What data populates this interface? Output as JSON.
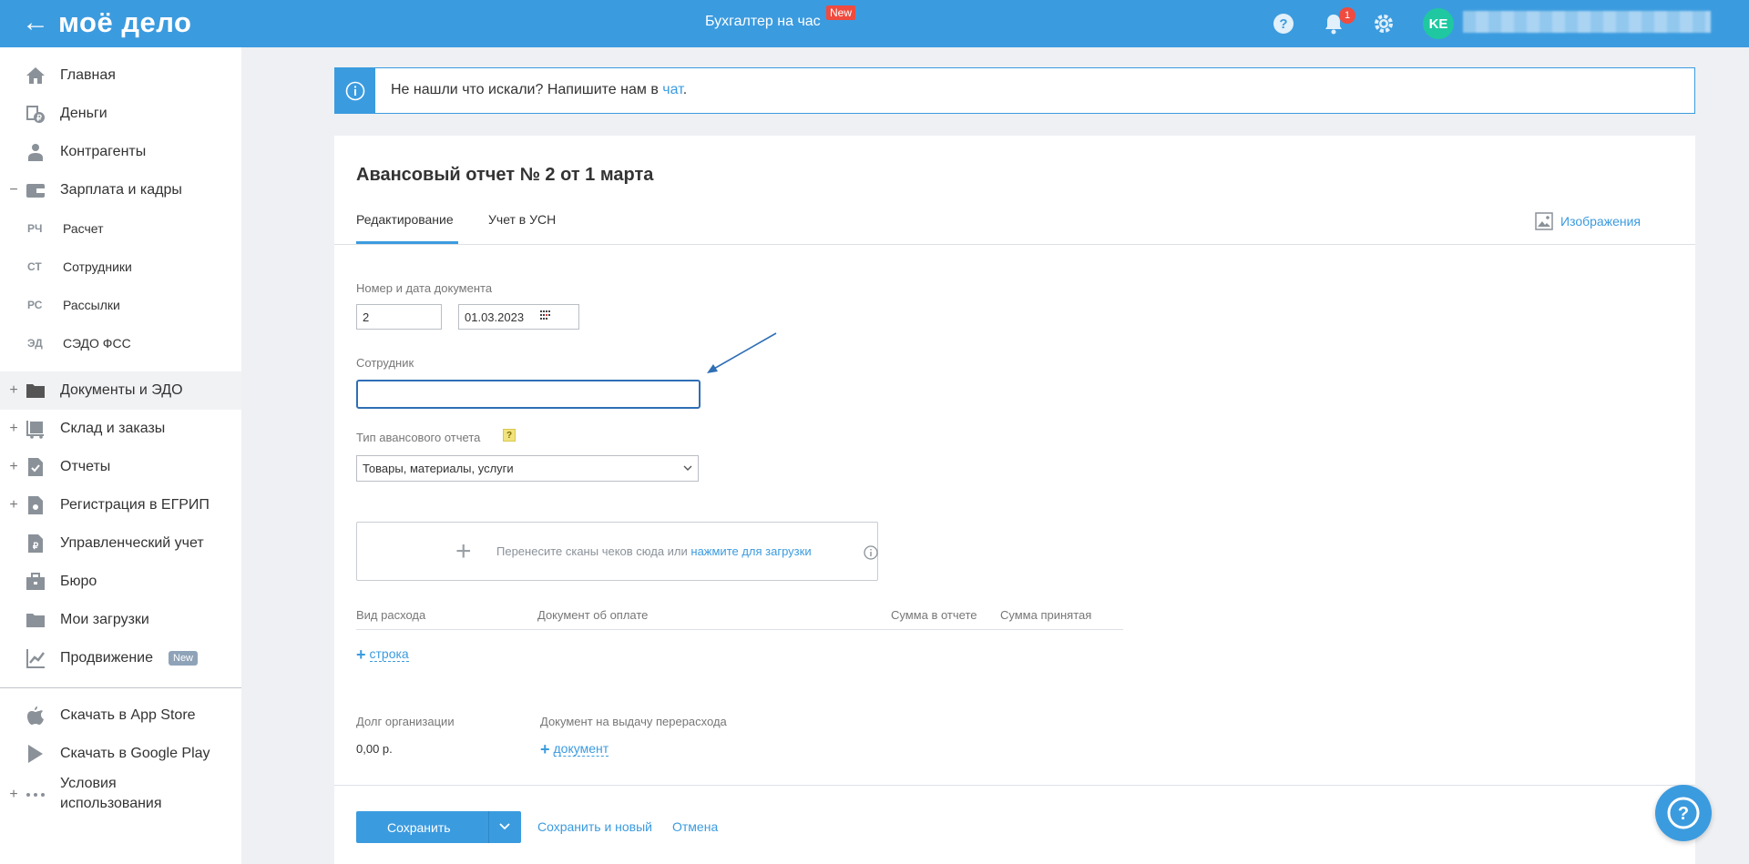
{
  "header": {
    "logo": "моё дело",
    "center_title": "Бухгалтер на час",
    "center_badge": "New",
    "notifications_count": "1",
    "avatar_initials": "KE"
  },
  "sidebar": {
    "items": [
      {
        "label": "Главная",
        "icon": "home-icon"
      },
      {
        "label": "Деньги",
        "icon": "money-icon"
      },
      {
        "label": "Контрагенты",
        "icon": "contractors-icon"
      },
      {
        "label": "Зарплата и кадры",
        "icon": "wallet-icon",
        "toggle": "−"
      },
      {
        "label": "Документы и ЭДО",
        "icon": "folder-icon",
        "toggle": "+"
      },
      {
        "label": "Склад и заказы",
        "icon": "warehouse-icon",
        "toggle": "+"
      },
      {
        "label": "Отчеты",
        "icon": "report-icon",
        "toggle": "+"
      },
      {
        "label": "Регистрация в ЕГРИП",
        "icon": "registration-icon",
        "toggle": "+"
      },
      {
        "label": "Управленческий учет",
        "icon": "management-icon"
      },
      {
        "label": "Бюро",
        "icon": "briefcase-icon"
      },
      {
        "label": "Мои загрузки",
        "icon": "downloads-folder-icon"
      },
      {
        "label": "Продвижение",
        "icon": "chart-icon",
        "badge": "New"
      },
      {
        "label": "Скачать в App Store",
        "icon": "apple-icon"
      },
      {
        "label": "Скачать в Google Play",
        "icon": "google-play-icon"
      },
      {
        "label": "Условия",
        "label2": "использования",
        "icon": "dots-icon",
        "toggle": "+"
      }
    ],
    "subitems": [
      {
        "abbr": "РЧ",
        "label": "Расчет"
      },
      {
        "abbr": "СТ",
        "label": "Сотрудники"
      },
      {
        "abbr": "РС",
        "label": "Рассылки"
      },
      {
        "abbr": "ЭД",
        "label": "СЭДО ФСС"
      }
    ]
  },
  "banner": {
    "text": "Не нашли что искали? Напишите нам в ",
    "link": "чат",
    "suffix": "."
  },
  "document": {
    "title": "Авансовый отчет № 2 от 1 марта",
    "tabs": [
      "Редактирование",
      "Учет в УСН"
    ],
    "images_link": "Изображения",
    "number_date_label": "Номер и дата документа",
    "number_value": "2",
    "date_value": "01.03.2023",
    "employee_label": "Сотрудник",
    "employee_value": "",
    "type_label": "Тип авансового отчета",
    "type_help": "?",
    "type_value": "Товары, материалы, услуги",
    "dropzone_text": "Перенесите сканы чеков сюда или ",
    "dropzone_link": "нажмите для загрузки",
    "table_headers": [
      "Вид расхода",
      "Документ об оплате",
      "Сумма в отчете",
      "Сумма принятая"
    ],
    "add_row_label": "строка",
    "debt_label": "Долг организации",
    "debt_value": "0,00 р.",
    "overspend_doc_label": "Документ на выдачу перерасхода",
    "add_doc_label": "документ"
  },
  "actions": {
    "save": "Сохранить",
    "save_and_new": "Сохранить и новый",
    "cancel": "Отмена"
  },
  "colors": {
    "accent": "#3b9bdf",
    "badge_red": "#ef4b3f",
    "avatar": "#1fc8a0"
  }
}
